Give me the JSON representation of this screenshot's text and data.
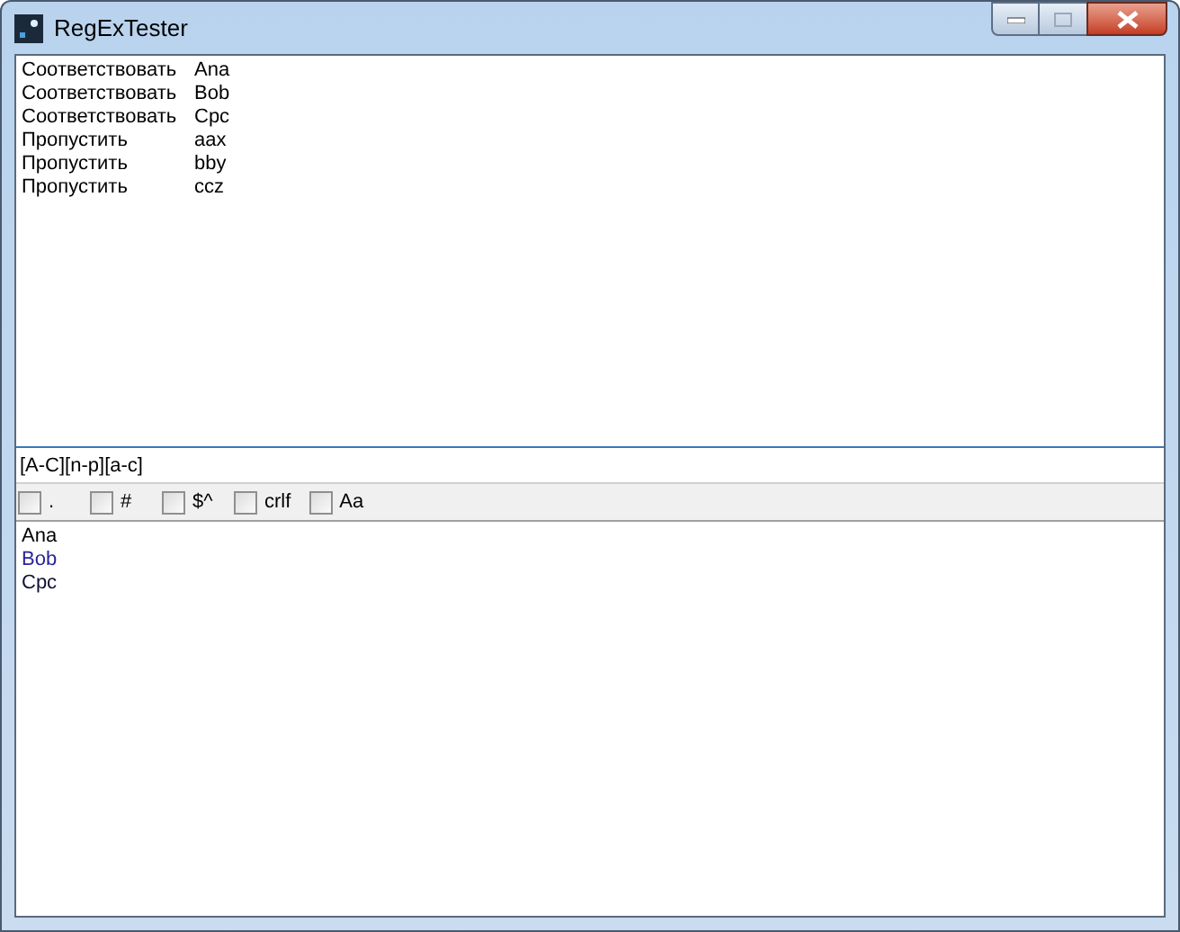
{
  "window": {
    "title": "RegExTester"
  },
  "tests": [
    {
      "action": "Соответствовать",
      "text": "Ana"
    },
    {
      "action": "Соответствовать",
      "text": "Bob"
    },
    {
      "action": "Соответствовать",
      "text": "Cpc"
    },
    {
      "action": "Пропустить",
      "text": "aax"
    },
    {
      "action": "Пропустить",
      "text": "bby"
    },
    {
      "action": "Пропустить",
      "text": "ccz"
    }
  ],
  "pattern": {
    "value": "[A-C][n-p][a-c]"
  },
  "options": [
    {
      "label": ".",
      "checked": false
    },
    {
      "label": "#",
      "checked": false
    },
    {
      "label": "$^",
      "checked": false
    },
    {
      "label": "crlf",
      "checked": false
    },
    {
      "label": "Aa",
      "checked": false
    }
  ],
  "results": [
    {
      "text": "Ana",
      "color": "#000000"
    },
    {
      "text": "Bob",
      "color": "#2b2299"
    },
    {
      "text": "Cpc",
      "color": "#101030"
    }
  ]
}
